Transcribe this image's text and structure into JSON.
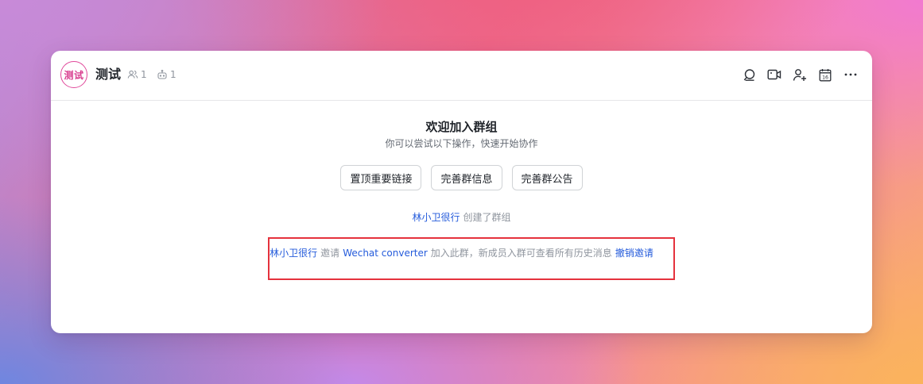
{
  "header": {
    "avatar_text": "测试",
    "group_name": "测试",
    "member_count": "1",
    "bot_count": "1"
  },
  "toolbar": {
    "icons": [
      "search-icon",
      "video-call-icon",
      "add-member-icon",
      "calendar-icon",
      "more-icon"
    ],
    "calendar_day": "16"
  },
  "welcome": {
    "title": "欢迎加入群组",
    "subtitle": "你可以尝试以下操作，快速开始协作"
  },
  "actions": {
    "pin_link": "置顶重要链接",
    "complete_info": "完善群信息",
    "complete_notice": "完善群公告"
  },
  "system": {
    "creator": "林小卫很行",
    "created_text": "创建了群组",
    "inviter": "林小卫很行",
    "invite_word": "邀请",
    "invitee": "Wechat converter",
    "invite_tail": "加入此群，新成员入群可查看所有历史消息",
    "revoke": "撤销邀请"
  },
  "colors": {
    "link": "#245bdb",
    "avatar_accent": "#e0489a",
    "highlight": "#e5323d"
  }
}
